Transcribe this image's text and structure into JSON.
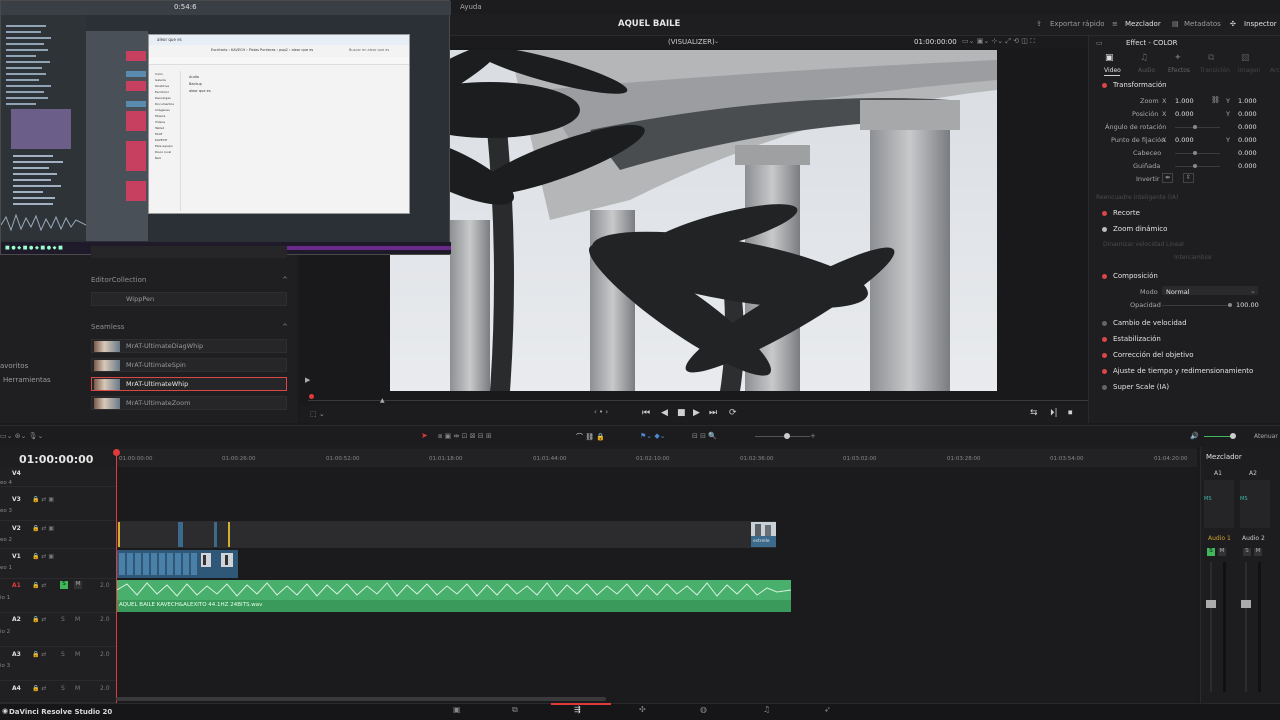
{
  "menubar": {
    "help_menu": "Ayuda"
  },
  "header": {
    "project_title": "AQUEL BAILE",
    "quick_export": "Exportar rápido",
    "mixer_btn": "Mezclador",
    "metadata_btn": "Metadatos",
    "inspector_btn": "Inspector"
  },
  "viewer": {
    "mode": "(VISUALIZER)",
    "timecode": "01:00:00:00"
  },
  "left_panel": {
    "collection_section": "EditorCollection",
    "collection_item": "WippPen",
    "seamless_section": "Seamless",
    "items": [
      "MrAT-UltimateDiagWhip",
      "MrAT-UltimateSpin",
      "MrAT-UltimateWhip",
      "MrAT-UltimateZoom"
    ],
    "side_items": [
      "avoritos",
      "Herramientas"
    ]
  },
  "inspector": {
    "title": "Effect - COLOR",
    "tabs": [
      "Video",
      "Audio",
      "Efectos",
      "Transición",
      "Imagen",
      "Arc"
    ],
    "sections": {
      "transform": "Transformación",
      "crop": "Recorte",
      "dynamic_zoom": "Zoom dinámico",
      "composite": "Composición",
      "speed_change": "Cambio de velocidad",
      "stabilization": "Estabilización",
      "lens_correction": "Corrección del objetivo",
      "retime": "Ajuste de tiempo y redimensionamiento",
      "super_scale": "Super Scale (IA)"
    },
    "fields": {
      "zoom": "Zoom",
      "position": "Posición",
      "rotation": "Ángulo de rotación",
      "anchor": "Punto de fijación",
      "pitch": "Cabeceo",
      "yaw": "Guiñada",
      "flip": "Invertir",
      "smart_reframe": "Reencuadre inteligente (IA)",
      "zoom_x": "1.000",
      "zoom_y": "1.000",
      "pos_x": "0.000",
      "pos_y": "0.000",
      "rot": "0.000",
      "anchor_x": "0.000",
      "anchor_y": "0.000",
      "pitch_val": "0.000",
      "yaw_val": "0.000",
      "dyn_ease_lbl": "Dinamizar velocidad",
      "dyn_ease_val": "Lineal",
      "swap": "Intercambiar",
      "mode_lbl": "Modo",
      "mode_val": "Normal",
      "opacity_lbl": "Opacidad",
      "opacity_val": "100.00"
    },
    "axis_x": "X",
    "axis_y": "Y"
  },
  "timeline": {
    "timecode": "01:00:00:00",
    "ruler": [
      "01:00:00:00",
      "01:00:26:00",
      "01:00:52:00",
      "01:01:18:00",
      "01:01:44:00",
      "01:02:10:00",
      "01:02:36:00",
      "01:03:02:00",
      "01:03:28:00",
      "01:03:54:00",
      "01:04:20:00"
    ],
    "tracks": [
      {
        "id": "V3",
        "side": "eo 3",
        "vol": ""
      },
      {
        "id": "V2",
        "side": "eo 2",
        "vol": ""
      },
      {
        "id": "V1",
        "side": "eo 1",
        "vol": ""
      },
      {
        "id": "A1",
        "side": "io 1",
        "vol": "2.0"
      },
      {
        "id": "A2",
        "side": "io 2",
        "vol": "2.0"
      },
      {
        "id": "A3",
        "side": "io 3",
        "vol": "2.0"
      },
      {
        "id": "A4",
        "side": "",
        "vol": "2.0"
      }
    ],
    "top_side": "eo 4",
    "audio_clip": "AQUEL BAILE KAVECH&ALEXITO 44.1HZ 24BITS.wav",
    "audio_letters": [
      "S",
      "M"
    ],
    "mute": "Atenuar",
    "v2_clip_tag": "estrelle"
  },
  "mixer": {
    "title": "Mezclador",
    "channels": [
      "A1",
      "A2"
    ],
    "names": [
      "Audio 1",
      "Audio 2"
    ],
    "bus_label": "MS"
  },
  "bottom": {
    "app_name": "DaVinci Resolve Studio 20"
  },
  "screen_share": {
    "timer": "0:54:6",
    "explorer_title": "aleor que es",
    "folder_path": "Escritorio › KAVECH › Pistas Punteras › pop2 › aleor que es",
    "search": "Buscar en aleor que es",
    "nav_items": [
      "Inicio",
      "Galería",
      "OneDrive",
      "Escritorio",
      "Descargas",
      "Documentos",
      "Imágenes",
      "Música",
      "Vídeos",
      "Tablet",
      "MrAT",
      "KAVECH",
      "Este equipo",
      "Disco local",
      "Red"
    ],
    "files": [
      "Audio",
      "Backup",
      "aleor que es"
    ]
  },
  "colors": {
    "accent_red": "#d84848",
    "audio_green": "#3a9a5c",
    "video_blue": "#3b6a8c",
    "playhead": "#e03a3a"
  }
}
